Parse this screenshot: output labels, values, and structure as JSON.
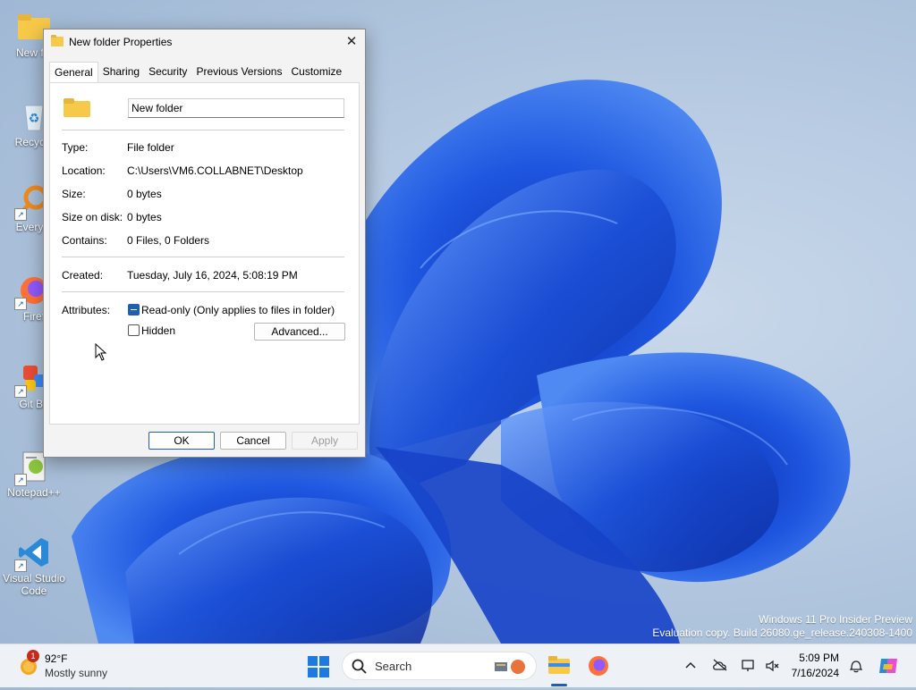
{
  "desktop": {
    "icons": [
      {
        "label": "New fol",
        "kind": "folder"
      },
      {
        "label": "Recycle",
        "kind": "recycle-bin"
      },
      {
        "label": "Everyth",
        "kind": "everything"
      },
      {
        "label": "Firef",
        "kind": "firefox"
      },
      {
        "label": "Git Ba",
        "kind": "git-bash"
      },
      {
        "label": "Notepad++",
        "kind": "notepad-plus-plus"
      },
      {
        "label": "Visual Studio Code",
        "kind": "vscode"
      }
    ]
  },
  "dialog": {
    "title": "New folder Properties",
    "close_symbol": "✕",
    "tabs": [
      {
        "label": "General",
        "active": true
      },
      {
        "label": "Sharing",
        "active": false
      },
      {
        "label": "Security",
        "active": false
      },
      {
        "label": "Previous Versions",
        "active": false
      },
      {
        "label": "Customize",
        "active": false
      }
    ],
    "name_value": "New folder",
    "properties": [
      {
        "key": "Type:",
        "value": "File folder"
      },
      {
        "key": "Location:",
        "value": "C:\\Users\\VM6.COLLABNET\\Desktop"
      },
      {
        "key": "Size:",
        "value": "0 bytes"
      },
      {
        "key": "Size on disk:",
        "value": "0 bytes"
      },
      {
        "key": "Contains:",
        "value": "0 Files, 0 Folders"
      }
    ],
    "created": {
      "key": "Created:",
      "value": "Tuesday, July 16, 2024, 5:08:19 PM"
    },
    "attributes": {
      "key": "Attributes:",
      "readonly_label": "Read-only (Only applies to files in folder)",
      "readonly_state": "indeterminate",
      "hidden_label": "Hidden",
      "hidden_checked": false,
      "advanced_label": "Advanced..."
    },
    "buttons": {
      "ok": "OK",
      "cancel": "Cancel",
      "apply": "Apply"
    }
  },
  "watermark": {
    "line1": "Windows 11 Pro Insider Preview",
    "line2": "Evaluation copy. Build 26080.ge_release.240308-1400"
  },
  "taskbar": {
    "weather": {
      "temp": "92°F",
      "condition": "Mostly sunny",
      "badge": "1"
    },
    "search_placeholder": "Search",
    "clock": {
      "time": "5:09 PM",
      "date": "7/16/2024"
    },
    "tray_icons": [
      "chevron-up-icon",
      "onedrive-offline-icon",
      "network-icon",
      "sound-icon",
      "notification-bell-icon",
      "copilot-icon"
    ],
    "pinned": [
      "start",
      "search",
      "file-explorer",
      "firefox"
    ]
  },
  "colors": {
    "accent": "#1e5fb3",
    "folder_yellow": "#f7c948",
    "bloom_blue": "#1f57e0"
  }
}
